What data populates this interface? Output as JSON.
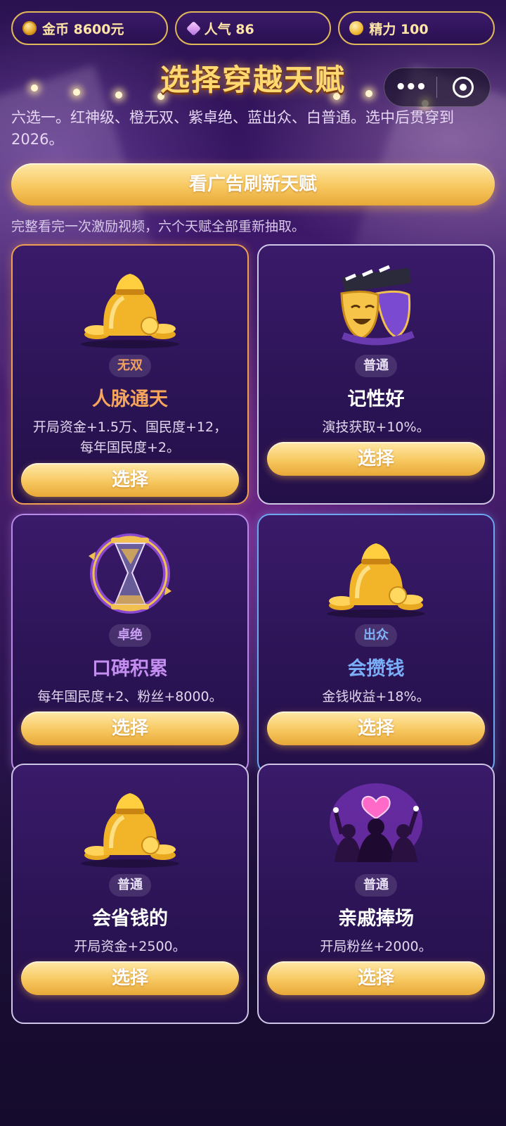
{
  "stats": {
    "coins": "金币 8600元",
    "popularity": "人气 86",
    "energy": "精力 100"
  },
  "title": "选择穿越天赋",
  "capsule": {
    "more": "•••"
  },
  "intro": "六选一。红神级、橙无双、紫卓绝、蓝出众、白普通。选中后贯穿到2026。",
  "refresh": {
    "label": "看广告刷新天赋",
    "note": "完整看完一次激励视频，六个天赋全部重新抽取。"
  },
  "colors": {
    "orange": "#f0a050",
    "purple": "#b98ae8",
    "blue": "#6ea6f0",
    "white": "#cfc6e6",
    "gold": "#f7c860"
  },
  "talents": [
    {
      "tier": "无双",
      "name": "人脉通天",
      "desc": "开局资金+1.5万、国民度+12，每年国民度+2。",
      "icon": "money-bag-icon",
      "action": "选择"
    },
    {
      "tier": "普通",
      "name": "记性好",
      "desc": "演技获取+10%。",
      "icon": "theater-masks-icon",
      "action": "选择"
    },
    {
      "tier": "卓绝",
      "name": "口碑积累",
      "desc": "每年国民度+2、粉丝+8000。",
      "icon": "hourglass-icon",
      "action": "选择"
    },
    {
      "tier": "出众",
      "name": "会攒钱",
      "desc": "金钱收益+18%。",
      "icon": "money-bag-icon",
      "action": "选择"
    },
    {
      "tier": "普通",
      "name": "会省钱的",
      "desc": "开局资金+2500。",
      "icon": "money-bag-icon",
      "action": "选择"
    },
    {
      "tier": "普通",
      "name": "亲戚捧场",
      "desc": "开局粉丝+2000。",
      "icon": "fans-cheering-icon",
      "action": "选择"
    }
  ]
}
